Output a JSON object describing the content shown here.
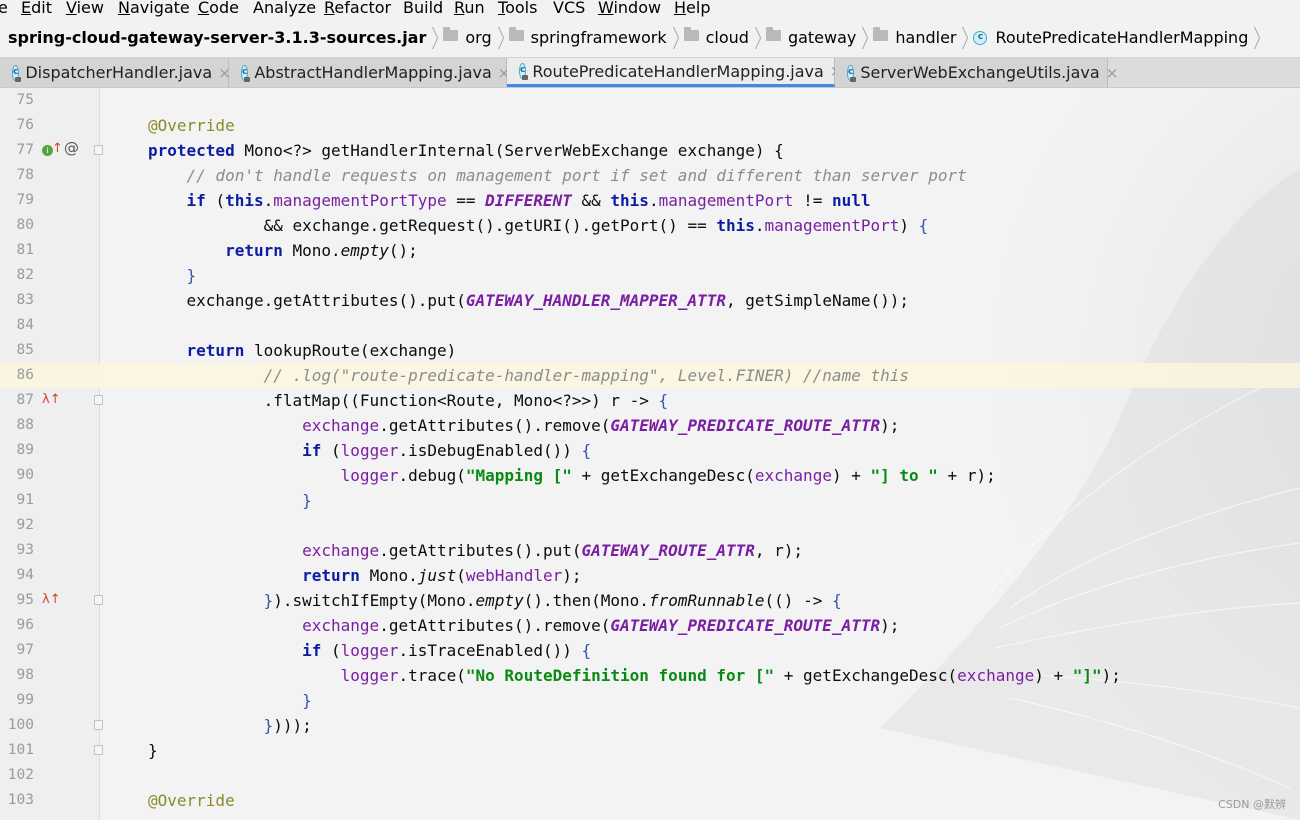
{
  "menu": {
    "items": [
      {
        "label": "e",
        "mnemonic": ""
      },
      {
        "label": "dit",
        "mnemonic": "E"
      },
      {
        "label": "iew",
        "mnemonic": "V"
      },
      {
        "label": "avigate",
        "mnemonic": "N"
      },
      {
        "label": "ode",
        "mnemonic": "C"
      },
      {
        "label": "Analyze",
        "mnemonic": ""
      },
      {
        "label": "efactor",
        "mnemonic": "R"
      },
      {
        "label": "Build",
        "mnemonic": ""
      },
      {
        "label": "un",
        "mnemonic": "R"
      },
      {
        "label": "ools",
        "mnemonic": "T"
      },
      {
        "label": "VCS",
        "mnemonic": ""
      },
      {
        "label": "indow",
        "mnemonic": "W"
      },
      {
        "label": "elp",
        "mnemonic": "H"
      }
    ]
  },
  "breadcrumb": {
    "root": "spring-cloud-gateway-server-3.1.3-sources.jar",
    "folders": [
      "org",
      "springframework",
      "cloud",
      "gateway",
      "handler"
    ],
    "class_name": "RoutePredicateHandlerMapping",
    "folder_icon": "folder-icon",
    "class_icon": "class-icon"
  },
  "tabs": [
    {
      "label": "DispatcherHandler.java",
      "close": "×",
      "active": false
    },
    {
      "label": "AbstractHandlerMapping.java",
      "close": "×",
      "active": false
    },
    {
      "label": "RoutePredicateHandlerMapping.java",
      "close": "×",
      "active": true
    },
    {
      "label": "ServerWebExchangeUtils.java",
      "close": "×",
      "active": false
    }
  ],
  "editor": {
    "highlighted_line": 86,
    "lines": [
      {
        "n": "75",
        "segments": []
      },
      {
        "n": "76",
        "segments": [
          [
            "ann",
            "@Override"
          ]
        ]
      },
      {
        "n": "77",
        "icons": [
          "impl",
          "override-up",
          "at"
        ],
        "fold": true,
        "segments": [
          [
            "kw",
            "protected "
          ],
          [
            "",
            "Mono<?> getHandlerInternal(ServerWebExchange exchange) {"
          ]
        ]
      },
      {
        "n": "78",
        "segments": [
          [
            "",
            "    "
          ],
          [
            "cmt",
            "// don't handle requests on management port if set and different than server port"
          ]
        ]
      },
      {
        "n": "79",
        "segments": [
          [
            "",
            "    "
          ],
          [
            "kw",
            "if "
          ],
          [
            "",
            "("
          ],
          [
            "kw",
            "this"
          ],
          [
            "",
            "."
          ],
          [
            "fld",
            "managementPortType"
          ],
          [
            "",
            " == "
          ],
          [
            "const",
            "DIFFERENT"
          ],
          [
            "",
            " && "
          ],
          [
            "kw",
            "this"
          ],
          [
            "",
            "."
          ],
          [
            "fld",
            "managementPort"
          ],
          [
            "",
            " != "
          ],
          [
            "kw",
            "null"
          ]
        ]
      },
      {
        "n": "80",
        "segments": [
          [
            "",
            "            && exchange.getRequest().getURI().getPort() == "
          ],
          [
            "kw",
            "this"
          ],
          [
            "",
            "."
          ],
          [
            "fld",
            "managementPort"
          ],
          [
            "",
            ") "
          ],
          [
            "brace",
            "{"
          ]
        ]
      },
      {
        "n": "81",
        "segments": [
          [
            "",
            "        "
          ],
          [
            "kw",
            "return "
          ],
          [
            "",
            "Mono."
          ],
          [
            "static",
            "empty"
          ],
          [
            "",
            "();"
          ]
        ]
      },
      {
        "n": "82",
        "segments": [
          [
            "",
            "    "
          ],
          [
            "brace",
            "}"
          ]
        ]
      },
      {
        "n": "83",
        "segments": [
          [
            "",
            "    exchange.getAttributes().put("
          ],
          [
            "const",
            "GATEWAY_HANDLER_MAPPER_ATTR"
          ],
          [
            "",
            ", getSimpleName());"
          ]
        ]
      },
      {
        "n": "84",
        "segments": []
      },
      {
        "n": "85",
        "segments": [
          [
            "",
            "    "
          ],
          [
            "kw",
            "return "
          ],
          [
            "",
            "lookupRoute(exchange)"
          ]
        ]
      },
      {
        "n": "86",
        "segments": [
          [
            "",
            "            "
          ],
          [
            "cmt",
            "// .log(\"route-predicate-handler-mapping\", Level.FINER) //name this"
          ]
        ]
      },
      {
        "n": "87",
        "icons": [
          "lambda"
        ],
        "fold": true,
        "segments": [
          [
            "",
            "            .flatMap((Function<Route, Mono<?>>) r -> "
          ],
          [
            "brace",
            "{"
          ]
        ]
      },
      {
        "n": "88",
        "segments": [
          [
            "",
            "                "
          ],
          [
            "fld",
            "exchange"
          ],
          [
            "",
            ".getAttributes().remove("
          ],
          [
            "const",
            "GATEWAY_PREDICATE_ROUTE_ATTR"
          ],
          [
            "",
            ");"
          ]
        ]
      },
      {
        "n": "89",
        "segments": [
          [
            "",
            "                "
          ],
          [
            "kw",
            "if "
          ],
          [
            "",
            "("
          ],
          [
            "fld",
            "logger"
          ],
          [
            "",
            ".isDebugEnabled()) "
          ],
          [
            "brace",
            "{"
          ]
        ]
      },
      {
        "n": "90",
        "segments": [
          [
            "",
            "                    "
          ],
          [
            "fld",
            "logger"
          ],
          [
            "",
            ".debug("
          ],
          [
            "str",
            "\"Mapping [\""
          ],
          [
            "",
            " + getExchangeDesc("
          ],
          [
            "fld",
            "exchange"
          ],
          [
            "",
            ") + "
          ],
          [
            "str",
            "\"] to \""
          ],
          [
            "",
            " + r);"
          ]
        ]
      },
      {
        "n": "91",
        "segments": [
          [
            "",
            "                "
          ],
          [
            "brace",
            "}"
          ]
        ]
      },
      {
        "n": "92",
        "segments": []
      },
      {
        "n": "93",
        "segments": [
          [
            "",
            "                "
          ],
          [
            "fld",
            "exchange"
          ],
          [
            "",
            ".getAttributes().put("
          ],
          [
            "const",
            "GATEWAY_ROUTE_ATTR"
          ],
          [
            "",
            ", r);"
          ]
        ]
      },
      {
        "n": "94",
        "segments": [
          [
            "",
            "                "
          ],
          [
            "kw",
            "return "
          ],
          [
            "",
            "Mono."
          ],
          [
            "static",
            "just"
          ],
          [
            "",
            "("
          ],
          [
            "fld",
            "webHandler"
          ],
          [
            "",
            ");"
          ]
        ]
      },
      {
        "n": "95",
        "icons": [
          "lambda"
        ],
        "fold": true,
        "segments": [
          [
            "",
            "            "
          ],
          [
            "brace",
            "}"
          ],
          [
            "",
            ").switchIfEmpty(Mono."
          ],
          [
            "static",
            "empty"
          ],
          [
            "",
            "().then(Mono."
          ],
          [
            "static",
            "fromRunnable"
          ],
          [
            "",
            "(() -> "
          ],
          [
            "brace",
            "{"
          ]
        ]
      },
      {
        "n": "96",
        "segments": [
          [
            "",
            "                "
          ],
          [
            "fld",
            "exchange"
          ],
          [
            "",
            ".getAttributes().remove("
          ],
          [
            "const",
            "GATEWAY_PREDICATE_ROUTE_ATTR"
          ],
          [
            "",
            ");"
          ]
        ]
      },
      {
        "n": "97",
        "segments": [
          [
            "",
            "                "
          ],
          [
            "kw",
            "if "
          ],
          [
            "",
            "("
          ],
          [
            "fld",
            "logger"
          ],
          [
            "",
            ".isTraceEnabled()) "
          ],
          [
            "brace",
            "{"
          ]
        ]
      },
      {
        "n": "98",
        "segments": [
          [
            "",
            "                    "
          ],
          [
            "fld",
            "logger"
          ],
          [
            "",
            ".trace("
          ],
          [
            "str",
            "\"No RouteDefinition found for [\""
          ],
          [
            "",
            " + getExchangeDesc("
          ],
          [
            "fld",
            "exchange"
          ],
          [
            "",
            ") + "
          ],
          [
            "str",
            "\"]\""
          ],
          [
            "",
            ");"
          ]
        ]
      },
      {
        "n": "99",
        "segments": [
          [
            "",
            "                "
          ],
          [
            "brace",
            "}"
          ]
        ]
      },
      {
        "n": "100",
        "fold": true,
        "segments": [
          [
            "",
            "            "
          ],
          [
            "brace",
            "}"
          ],
          [
            "",
            ")));"
          ]
        ]
      },
      {
        "n": "101",
        "fold": true,
        "segments": [
          [
            "",
            "}"
          ]
        ]
      },
      {
        "n": "102",
        "segments": []
      },
      {
        "n": "103",
        "segments": [
          [
            "ann",
            "@Override"
          ]
        ]
      }
    ]
  },
  "watermark": "CSDN @默辨",
  "colors": {
    "keyword": "#0b1ea3",
    "string": "#0a8a14",
    "comment": "#8c8c8c",
    "field": "#7a1fa2",
    "annotation": "#8a8a2a",
    "active_tab_accent": "#3d8ce0"
  }
}
